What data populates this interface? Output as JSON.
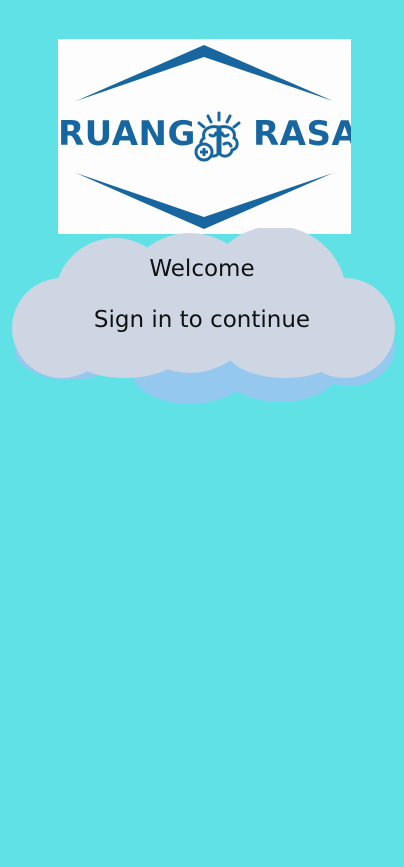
{
  "logo": {
    "text_left": "RUANG",
    "text_right": "RASA",
    "icon": "brain-icon",
    "color": "#1866a0"
  },
  "cloud": {
    "welcome": "Welcome",
    "subtitle": "Sign in to continue",
    "fill_color": "#cdd6e2",
    "shadow_color": "#94c8ee"
  },
  "colors": {
    "background": "#5fe1e6"
  }
}
